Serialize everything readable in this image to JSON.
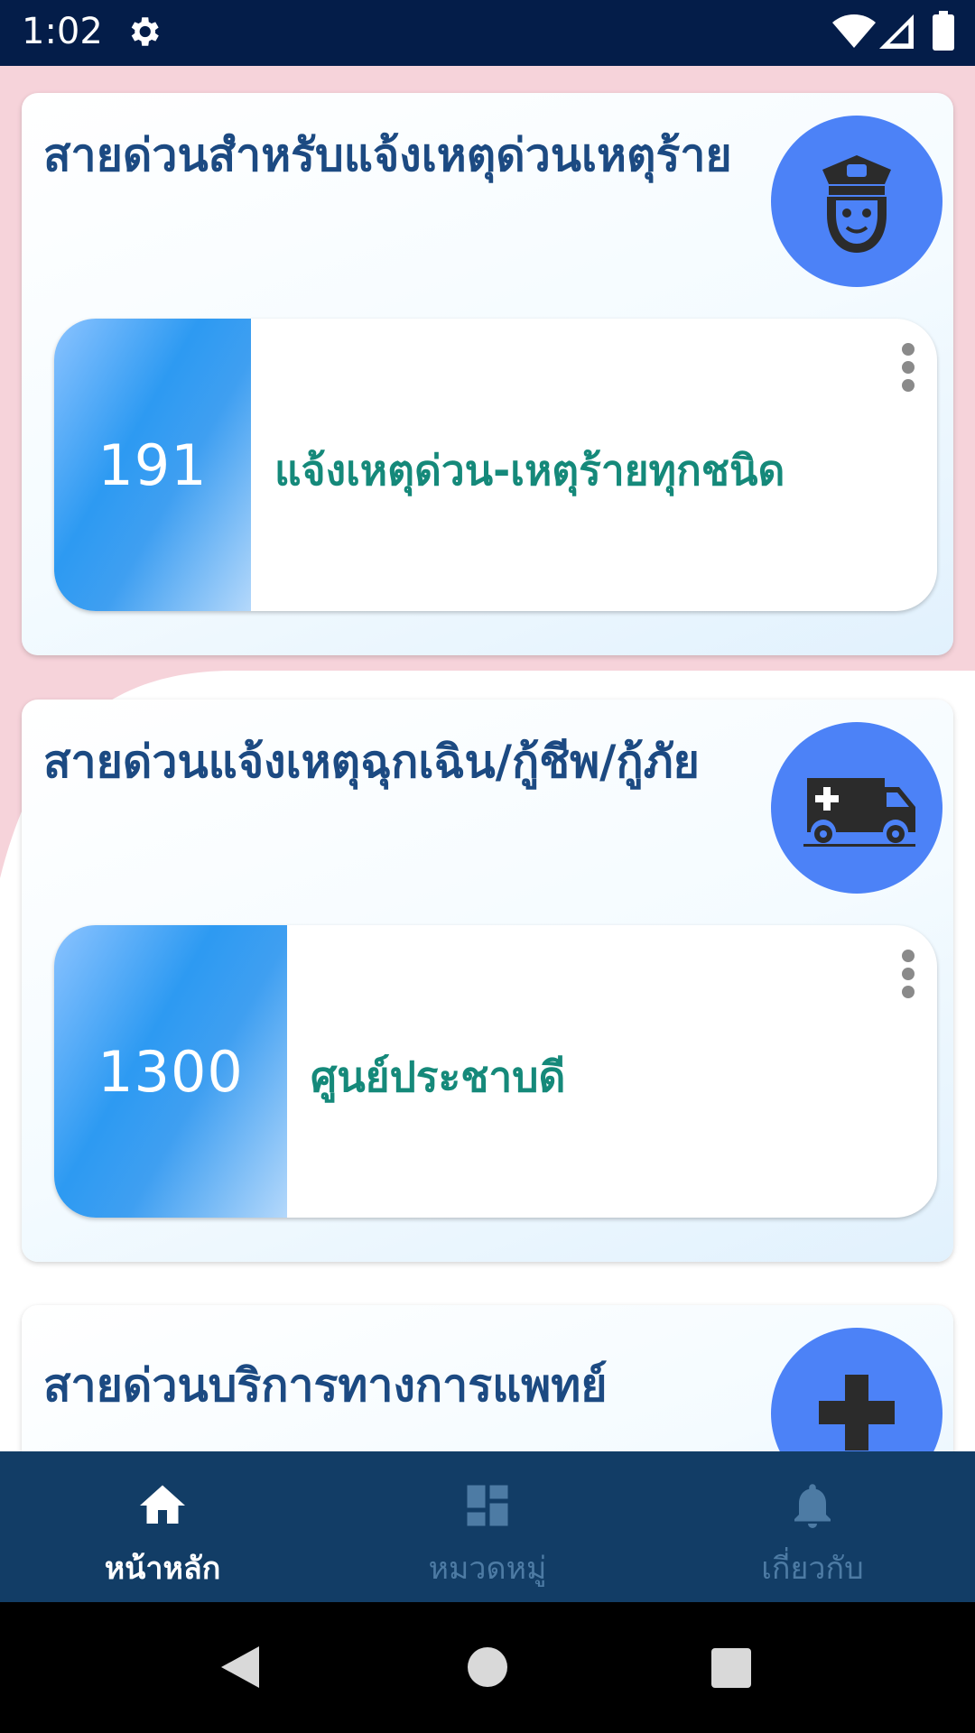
{
  "status_bar": {
    "time": "1:02"
  },
  "categories": [
    {
      "title": "สายด่วนสำหรับแจ้งเหตุด่วนเหตุร้าย",
      "icon": "police-officer-icon",
      "entries": [
        {
          "number": "191",
          "label": "แจ้งเหตุด่วน-เหตุร้ายทุกชนิด"
        }
      ]
    },
    {
      "title": "สายด่วนแจ้งเหตุฉุกเฉิน/กู้ชีพ/กู้ภัย",
      "icon": "ambulance-icon",
      "entries": [
        {
          "number": "1300",
          "label": "ศูนย์ประชาบดี"
        }
      ]
    },
    {
      "title": "สายด่วนบริการทางการแพทย์",
      "icon": "medical-cross-icon",
      "entries": []
    }
  ],
  "bottom_nav": [
    {
      "label": "หน้าหลัก",
      "icon": "home-icon",
      "active": true
    },
    {
      "label": "หมวดหมู่",
      "icon": "dashboard-icon",
      "active": false
    },
    {
      "label": "เกี่ยวกับ",
      "icon": "bell-icon",
      "active": false
    }
  ],
  "colors": {
    "status_bar": "#041d49",
    "bottom_nav": "#123d66",
    "accent_circle": "#4c82f7",
    "title_text": "#1c4a82",
    "entry_label": "#15897a",
    "pink_background": "#f6d3da"
  }
}
